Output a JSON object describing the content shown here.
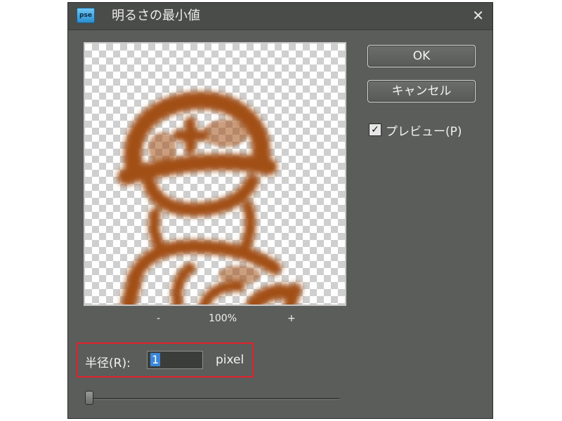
{
  "window": {
    "app_icon_text": "pse",
    "title": "明るさの最小値",
    "close_symbol": "✕"
  },
  "preview": {
    "zoom_out": "-",
    "zoom_level": "100%",
    "zoom_in": "+"
  },
  "buttons": {
    "ok": "OK",
    "cancel": "キャンセル"
  },
  "preview_checkbox": {
    "checked": true,
    "checkmark": "✓",
    "label": "プレビュー(P)"
  },
  "radius": {
    "label": "半径(R):",
    "value": "1",
    "unit": "pixel",
    "slider_fraction": 0.0
  },
  "colors": {
    "dialog_bg": "#5b5d5b",
    "image_brown": "#a24f19",
    "highlight_red": "#e0202a"
  }
}
